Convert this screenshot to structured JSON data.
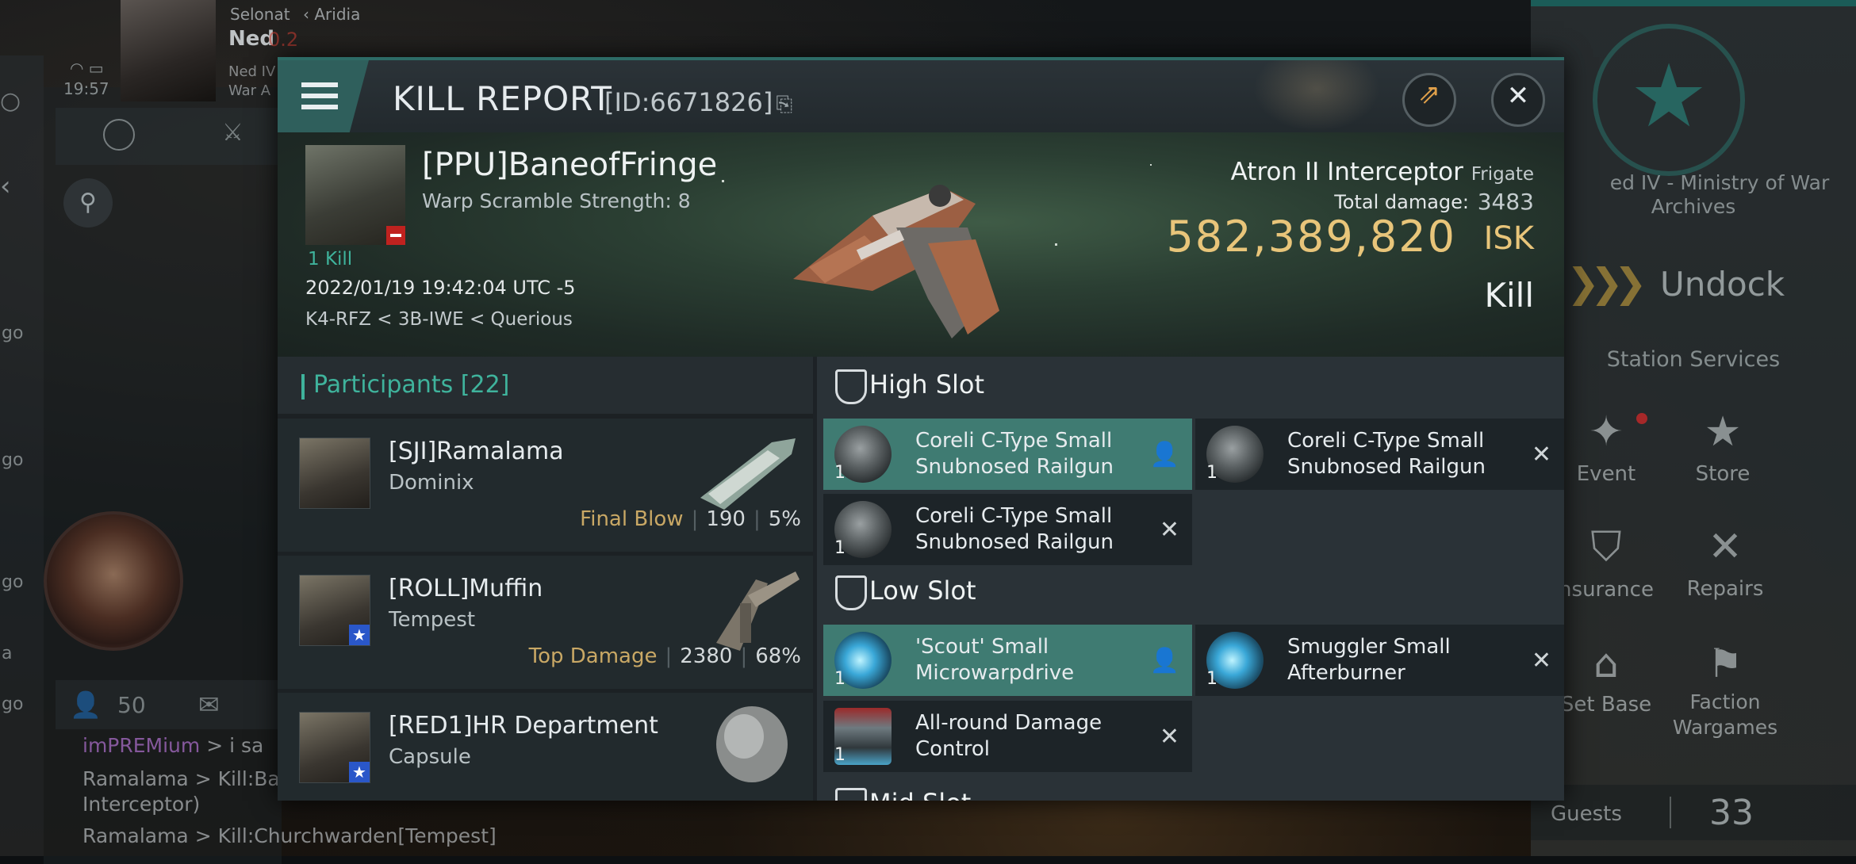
{
  "hud": {
    "player_corp": "Selonat",
    "player_region": "Aridia",
    "player_name": "Ned",
    "security": "0.2",
    "clock": "19:57",
    "player_sub1": "Ned IV",
    "player_sub2": "War A",
    "online_count": "50",
    "guests_label": "Guests",
    "guests_count": "33",
    "side_labels": [
      "go",
      "go",
      "go",
      "a",
      "go"
    ]
  },
  "station": {
    "name_line1": "ed IV - Ministry of War",
    "name_line2": "Archives",
    "undock_label": "Undock",
    "services_label": "Station Services",
    "services": [
      {
        "label": "Event",
        "icon": "party-icon"
      },
      {
        "label": "Store",
        "icon": "neS-store-icon"
      },
      {
        "label": "nsurance",
        "icon": "insurance-icon"
      },
      {
        "label": "Repairs",
        "icon": "wrench-icon"
      },
      {
        "label": "Set Base",
        "icon": "set-base-icon"
      },
      {
        "label": "Faction Wargames",
        "icon": "crossed-flags-icon"
      }
    ]
  },
  "chat": {
    "line1_user": "imPREMium",
    "line1_text": "> i sa",
    "line2": "Ramalama > Kill:Ban",
    "line3": "Interceptor)",
    "line4": "Ramalama > Kill:Churchwarden[Tempest]"
  },
  "kill_report": {
    "title": "KILL REPORT",
    "id": "[ID:6671826]",
    "victim": {
      "name": "[PPU]BaneofFringe",
      "warp_scramble": "Warp Scramble Strength: 8",
      "kills": "1 Kill",
      "datetime": "2022/01/19 19:42:04 UTC -5",
      "location": "K4-RFZ < 3B-IWE < Querious"
    },
    "ship": {
      "name": "Atron II Interceptor",
      "class": "Frigate",
      "total_damage_label": "Total damage:",
      "total_damage": "3483",
      "isk_value": "582,389,820",
      "isk_unit": "ISK",
      "result": "Kill"
    },
    "participants_title": "Participants",
    "participants_count": "[22]",
    "participants": [
      {
        "name": "[SJI]Ramalama",
        "ship": "Dominix",
        "tag": "Final Blow",
        "damage": "190",
        "percent": "5%",
        "star": false
      },
      {
        "name": "[ROLL]Muffin",
        "ship": "Tempest",
        "tag": "Top Damage",
        "damage": "2380",
        "percent": "68%",
        "star": true
      },
      {
        "name": "[RED1]HR Department",
        "ship": "Capsule",
        "tag": "",
        "damage": "",
        "percent": "",
        "star": true
      }
    ],
    "high_slot_label": "High Slot",
    "high_slots": [
      {
        "name": "Coreli C-Type Small Snubnosed Railgun",
        "qty": "1",
        "state": "active"
      },
      {
        "name": "Coreli C-Type Small Snubnosed Railgun",
        "qty": "1",
        "state": "destroyed"
      },
      {
        "name": "Coreli C-Type Small Snubnosed Railgun",
        "qty": "1",
        "state": "destroyed"
      }
    ],
    "low_slot_label": "Low Slot",
    "low_slots": [
      {
        "name": "'Scout' Small Microwarpdrive",
        "qty": "1",
        "state": "active"
      },
      {
        "name": "Smuggler Small Afterburner",
        "qty": "1",
        "state": "destroyed"
      },
      {
        "name": "All-round Damage Control",
        "qty": "1",
        "state": "destroyed"
      }
    ],
    "mid_slot_label": "Mid Slot"
  }
}
